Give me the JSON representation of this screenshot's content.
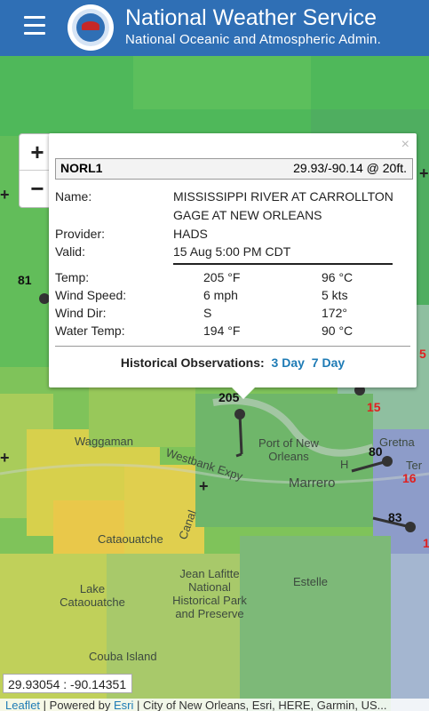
{
  "header": {
    "title": "National Weather Service",
    "subtitle": "National Oceanic and Atmospheric Admin."
  },
  "map": {
    "zoom_in": "+",
    "zoom_out": "−",
    "places": [
      "Waggaman",
      "Port of New Orleans",
      "Westbank Expy",
      "Marrero",
      "Gretna",
      "Cataouatche",
      "Lake Cataouatche",
      "Jean Lafitte National Historical Park and Preserve",
      "Estelle",
      "Couba Island",
      "Canal",
      "Ter",
      "H"
    ],
    "markers": {
      "m1": "81",
      "m2": "205",
      "m3": "15",
      "m4": "80",
      "m5": "16",
      "m6": "83",
      "m7": "5",
      "m8": "1"
    },
    "coords": "29.93054 : -90.14351",
    "attribution": {
      "leaflet": "Leaflet",
      "powered": "Powered by",
      "esri": "Esri",
      "rest": "City of New Orleans, Esri, HERE, Garmin, US..."
    }
  },
  "popup": {
    "close": "×",
    "station_id": "NORL1",
    "latlon": "29.93/-90.14 @ 20ft.",
    "name_label": "Name:",
    "name_line1": "MISSISSIPPI RIVER AT CARROLLTON",
    "name_line2": "GAGE AT NEW ORLEANS",
    "provider_label": "Provider:",
    "provider": "HADS",
    "valid_label": "Valid:",
    "valid": "15 Aug 5:00 PM CDT",
    "rows": [
      {
        "label": "Temp:",
        "v1": "205 °F",
        "v2": "96 °C"
      },
      {
        "label": "Wind Speed:",
        "v1": "6 mph",
        "v2": "5 kts"
      },
      {
        "label": "Wind Dir:",
        "v1": "S",
        "v2": "172°"
      },
      {
        "label": "Water Temp:",
        "v1": "194 °F",
        "v2": "90 °C"
      }
    ],
    "hist_label": "Historical Observations:",
    "hist_3day": "3 Day",
    "hist_7day": "7 Day"
  },
  "colors": {
    "header_bg": "#2f6fb5",
    "link": "#1e7bb5",
    "warm_temp": "#e02020"
  }
}
